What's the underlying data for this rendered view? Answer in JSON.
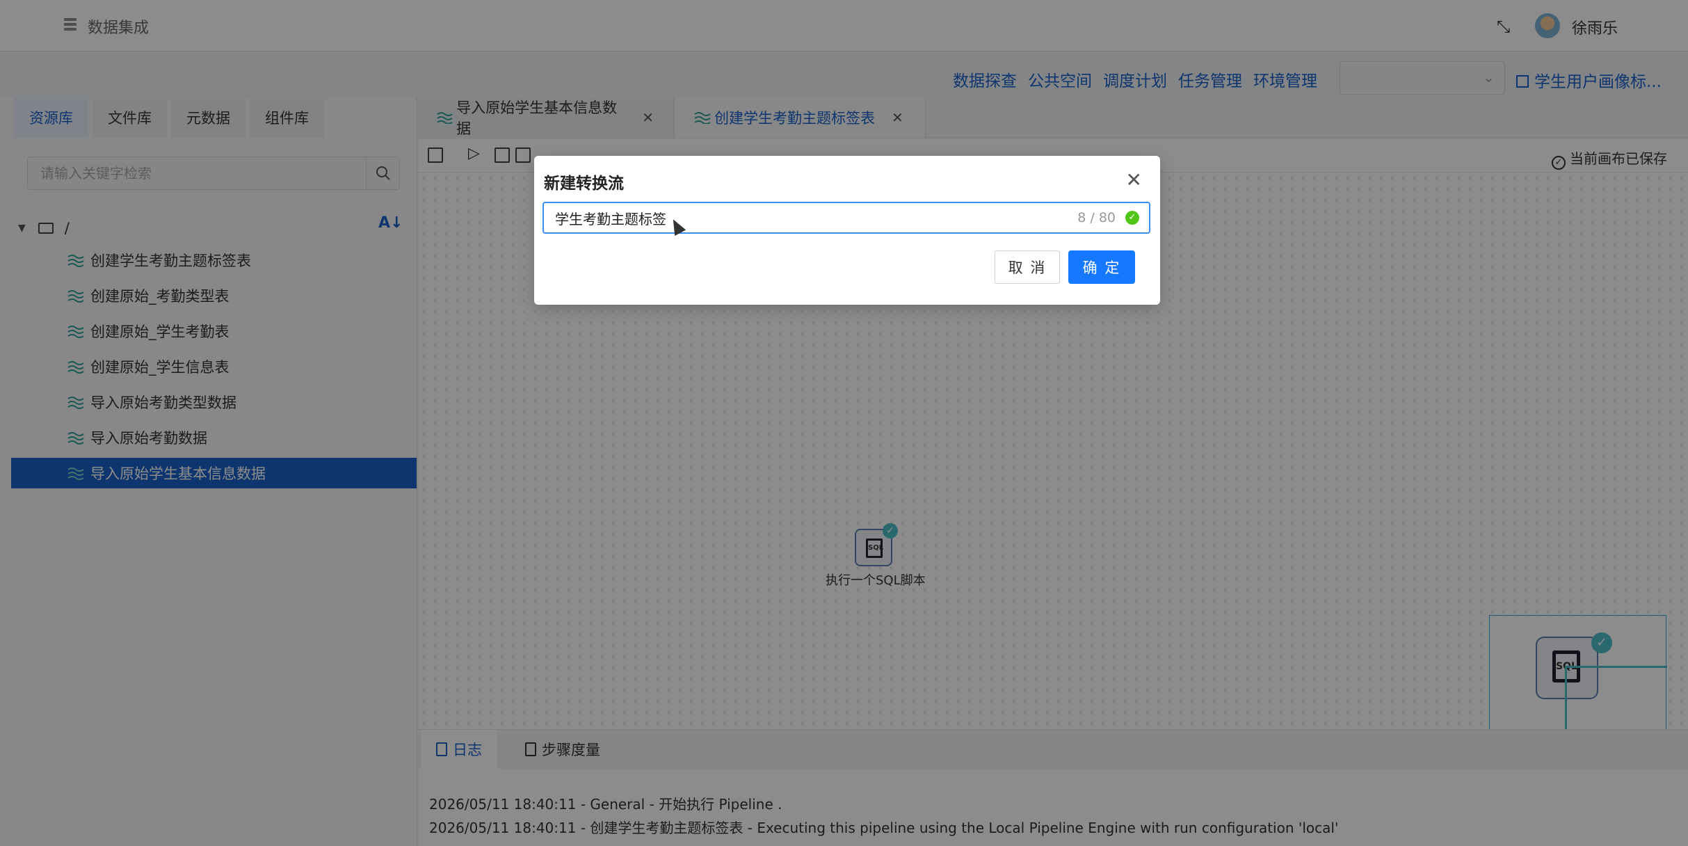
{
  "topbar": {
    "app_title": "数据集成",
    "username": "徐雨乐"
  },
  "nav": {
    "links": [
      "数据探查",
      "公共空间",
      "调度计划",
      "任务管理",
      "环境管理"
    ],
    "select_value": "",
    "project": "学生用户画像标..."
  },
  "leftpanel": {
    "tabs": [
      "资源库",
      "文件库",
      "元数据",
      "组件库"
    ],
    "active_tab": "资源库",
    "search_placeholder": "请输入关键字检索",
    "root": "/",
    "items": [
      "创建学生考勤主题标签表",
      "创建原始_考勤类型表",
      "创建原始_学生考勤表",
      "创建原始_学生信息表",
      "导入原始考勤类型数据",
      "导入原始考勤数据",
      "导入原始学生基本信息数据"
    ],
    "selected_item": "导入原始学生基本信息数据"
  },
  "editor": {
    "tabs": [
      "导入原始学生基本信息数据",
      "创建学生考勤主题标签表"
    ],
    "active_tab": "创建学生考勤主题标签表",
    "saved_status": "当前画布已保存",
    "step_label": "执行一个SQL脚本",
    "step_icon_text": "SQL"
  },
  "logpanel": {
    "tabs": [
      "日志",
      "步骤度量"
    ],
    "active_tab": "日志",
    "lines": [
      "2026/05/11 18:40:11 - General - 开始执行 Pipeline .",
      "2026/05/11 18:40:11 - 创建学生考勤主题标签表 - Executing this pipeline using the Local Pipeline Engine with run configuration 'local'"
    ]
  },
  "modal": {
    "title": "新建转换流",
    "input_value": "学生考勤主题标签",
    "count": "8 / 80",
    "cancel_label": "取 消",
    "ok_label": "确 定"
  },
  "colors": {
    "accent": "#1a62c8",
    "primary_button": "#1677ff",
    "success": "#52c41a",
    "node_check": "#4bbfc7"
  },
  "icons": [
    "menu-icon",
    "fullscreen-icon",
    "search-icon",
    "folder-icon",
    "sort-icon",
    "pipeline-icon",
    "close-icon",
    "check-circle-icon",
    "sql-icon",
    "log-icon",
    "metrics-icon"
  ]
}
